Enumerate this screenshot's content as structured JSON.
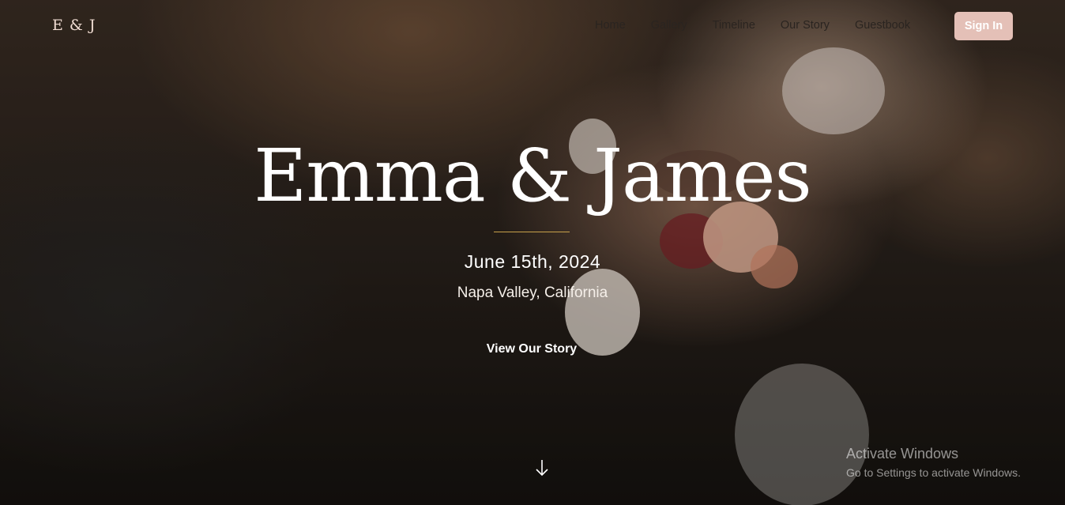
{
  "nav": {
    "logo": "E & J",
    "links": [
      "Home",
      "Gallery",
      "Timeline",
      "Our Story",
      "Guestbook"
    ],
    "sign_in": "Sign In"
  },
  "hero": {
    "title": "Emma & James",
    "date": "June 15th, 2024",
    "location": "Napa Valley, California",
    "cta": "View Our Story",
    "scroll_icon": "arrow-down-icon"
  },
  "watermark": {
    "title": "Activate Windows",
    "subtitle": "Go to Settings to activate Windows."
  },
  "colors": {
    "accent_line": "#c7a14a",
    "sign_in_bg": "#e4c0b7",
    "nav_text": "#2a2420"
  }
}
